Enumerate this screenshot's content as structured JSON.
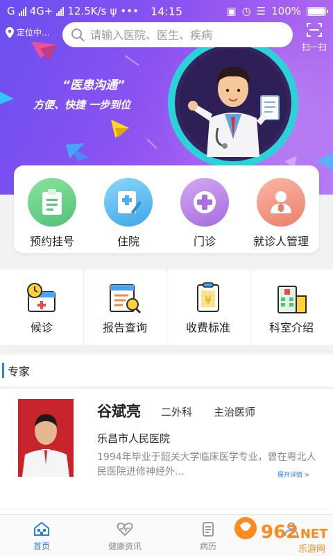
{
  "status_bar": {
    "carrier_left": "G",
    "network": "4G+",
    "speed": "12.5K/s",
    "extra": "•••",
    "time": "14:15",
    "battery": "100%"
  },
  "header": {
    "location": "定位中...",
    "search_placeholder": "请输入医院、医生、疾病",
    "scan_label": "扫一扫"
  },
  "banner": {
    "title": "“医患沟通”",
    "subtitle": "方便、快捷  一步到位"
  },
  "quick_actions": [
    {
      "label": "预约挂号",
      "icon": "clipboard-icon",
      "color": "#6fd38b"
    },
    {
      "label": "住院",
      "icon": "hospital-form-icon",
      "color": "#5cb8f0"
    },
    {
      "label": "门诊",
      "icon": "medical-cross-icon",
      "color": "#b782e8"
    },
    {
      "label": "就诊人管理",
      "icon": "patient-icon",
      "color": "#f0927e"
    }
  ],
  "services": [
    {
      "label": "候诊",
      "icon": "waiting-clock-icon"
    },
    {
      "label": "报告查询",
      "icon": "report-search-icon"
    },
    {
      "label": "收费标准",
      "icon": "fee-standard-icon"
    },
    {
      "label": "科室介绍",
      "icon": "department-icon"
    }
  ],
  "expert_section": {
    "title": "专家"
  },
  "doctors": [
    {
      "name": "谷斌亮",
      "department": "二外科",
      "title": "主治医师",
      "hospital": "乐昌市人民医院",
      "bio": "1994年毕业于韶关大学临床医学专业，曾在粤北人民医院进修神经外…",
      "more_label": "展开详情 >"
    }
  ],
  "bottom_nav": [
    {
      "label": "首页",
      "icon": "home-icon",
      "active": true
    },
    {
      "label": "健康资讯",
      "icon": "heart-pulse-icon",
      "active": false
    },
    {
      "label": "病历",
      "icon": "medical-record-icon",
      "active": false
    },
    {
      "label": "",
      "icon": "profile-icon",
      "active": false
    }
  ],
  "watermark": {
    "brand": "962",
    "suffix": ".NET",
    "caption": "乐游网"
  },
  "colors": {
    "hero_start": "#6a4ff0",
    "hero_end": "#b77cf4",
    "accent_blue": "#2b7de9"
  }
}
